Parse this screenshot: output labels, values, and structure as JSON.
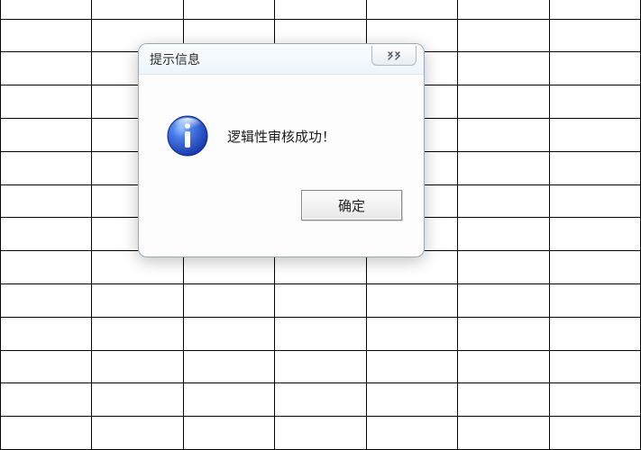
{
  "dialog": {
    "title": "提示信息",
    "message": "逻辑性审核成功！",
    "ok_label": "确定"
  }
}
